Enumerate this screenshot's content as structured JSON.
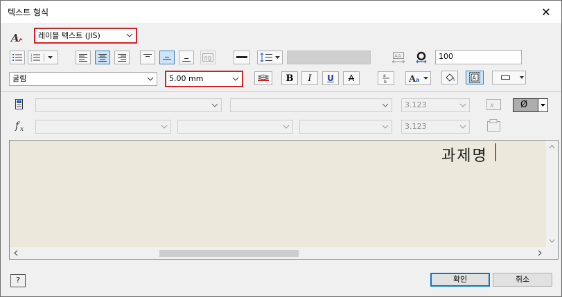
{
  "window": {
    "title": "텍스트 형식",
    "close_glyph": "✕"
  },
  "style_combo": {
    "value": "레이블 텍스트 (JIS)"
  },
  "font_combo": {
    "value": "굴림"
  },
  "size_combo": {
    "value": "5.00 mm"
  },
  "stretch_field": {
    "value": "100"
  },
  "bold_label": "B",
  "italic_label": "I",
  "underline_label": "U",
  "strike_label": "A",
  "diameter_symbol": "Ø",
  "param_row": {
    "value1": "3.123"
  },
  "func_row": {
    "value1": "3.123"
  },
  "editor": {
    "text": "과제명"
  },
  "footer": {
    "ok_label": "확인",
    "cancel_label": "취소",
    "help_glyph": "?"
  }
}
